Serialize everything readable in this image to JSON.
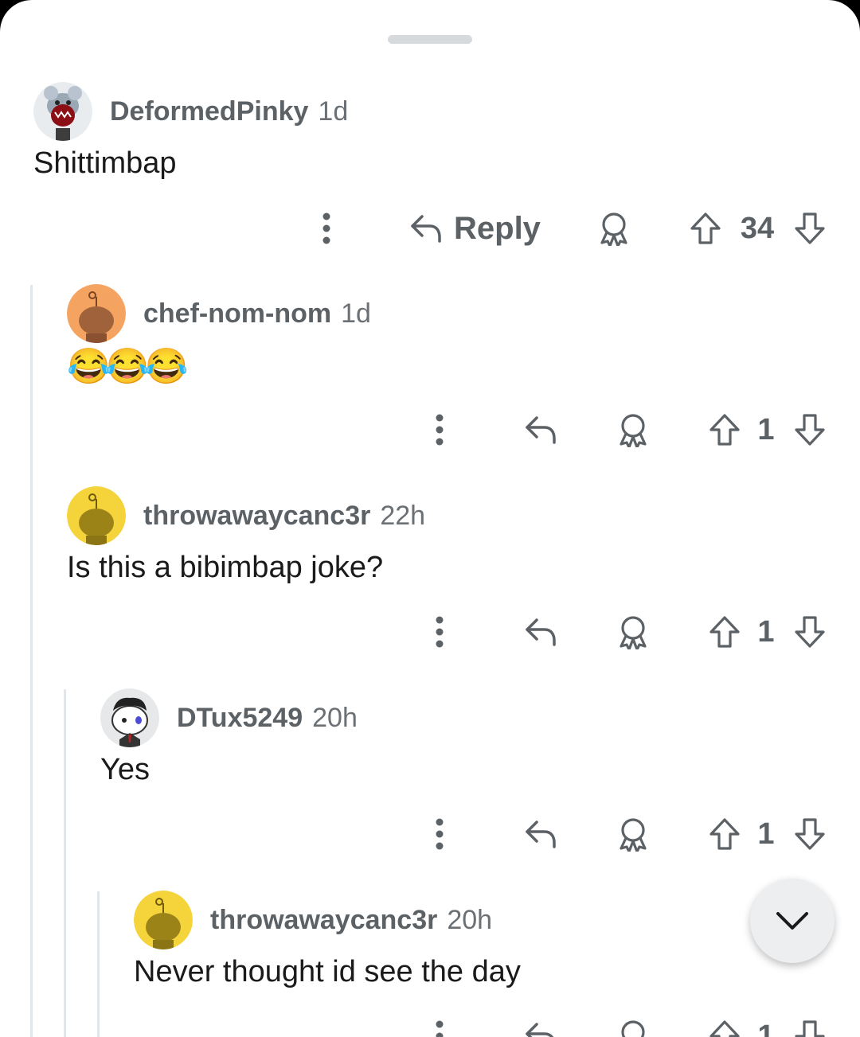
{
  "comments": [
    {
      "username": "DeformedPinky",
      "time": "1d",
      "body": "Shittimbap",
      "reply_label": "Reply",
      "votes": "34"
    },
    {
      "username": "chef-nom-nom",
      "time": "1d",
      "body": "😂😂😂",
      "votes": "1"
    },
    {
      "username": "throwawaycanc3r",
      "time": "22h",
      "body": "Is this a bibimbap joke?",
      "votes": "1"
    },
    {
      "username": "DTux5249",
      "time": "20h",
      "body": "Yes",
      "votes": "1"
    },
    {
      "username": "throwawaycanc3r",
      "time": "20h",
      "body": "Never thought id see the day",
      "votes": "1"
    }
  ],
  "colors": {
    "text": "#1a1a1b",
    "meta": "#5c6166",
    "thread_line": "#e3e6e8",
    "avatar_orange": "#f4a460",
    "avatar_yellow": "#f5d33a"
  },
  "icons": [
    "more-icon",
    "reply-icon",
    "award-icon",
    "upvote-icon",
    "downvote-icon",
    "chevron-down-icon"
  ]
}
